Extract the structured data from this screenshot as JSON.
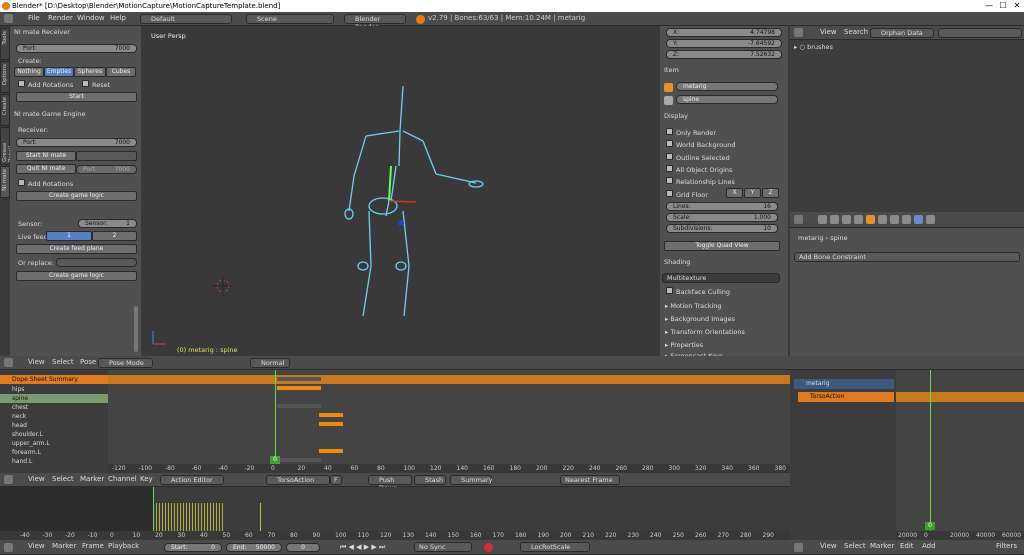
{
  "window": {
    "title": "Blender* [D:\\Desktop\\Blender\\MotionCapture\\MotionCaptureTemplate.blend]",
    "min": "—",
    "max": "☐",
    "close": "✕"
  },
  "info_header": {
    "menus": [
      "File",
      "Render",
      "Window",
      "Help"
    ],
    "layout": "Default",
    "scene": "Scene",
    "engine": "Blender Render",
    "stats": "v2.79 | Bones:63/63 | Mem:10.24M | metarig"
  },
  "left_tabs": [
    "Tools",
    "Options",
    "Create",
    "Grease Pencil",
    "NI mate"
  ],
  "ni_receiver": {
    "title": "NI mate Receiver",
    "port_label": "Port:",
    "port_value": "7000",
    "create_label": "Create:",
    "create_opts": [
      "Nothing",
      "Empties",
      "Spheres",
      "Cubes"
    ],
    "add_rotations": "Add Rotations",
    "reset": "Reset",
    "start": "Start"
  },
  "ni_game": {
    "title": "NI mate Game Engine",
    "receiver_label": "Receiver:",
    "port_label": "Port:",
    "port_value": "7000",
    "start_ni": "Start NI mate",
    "quit_ni": "Quit NI mate",
    "port2_label": "Port:",
    "port2_value": "7000",
    "add_rotations": "Add Rotations",
    "create_logic": "Create game logic",
    "sensor_label": "Sensor:",
    "sensor_field": "Sensor:",
    "sensor_value": "1",
    "livefeed_label": "Live feed:",
    "feed1": "1",
    "feed2": "2",
    "create_feed": "Create feed plane",
    "or_replace": "Or replace:",
    "create_logic2": "Create game logic"
  },
  "viewport": {
    "label": "User Persp",
    "status": "(0) metarig : spine"
  },
  "view3d_header": {
    "menus": [
      "View",
      "Select",
      "Pose"
    ],
    "mode": "Pose Mode",
    "pivot": "Normal"
  },
  "props": {
    "x_label": "X:",
    "x": "4.74798",
    "y_label": "Y:",
    "y": "-7.64592",
    "z_label": "Z:",
    "z": "7.52632",
    "item_title": "Item",
    "obj_name": "metarig",
    "bone_name": "spine",
    "display_title": "Display",
    "only_render": "Only Render",
    "world_bg": "World Background",
    "outline_sel": "Outline Selected",
    "all_origins": "All Object Origins",
    "rel_lines": "Relationship Lines",
    "grid_floor": "Grid Floor",
    "gx": "X",
    "gy": "Y",
    "gz": "Z",
    "lines_label": "Lines:",
    "lines": "16",
    "scale_label": "Scale:",
    "scale": "1.000",
    "subdiv_label": "Subdivisions:",
    "subdiv": "10",
    "toggle_quad": "Toggle Quad View",
    "shading_title": "Shading",
    "shading_mode": "Multitexture",
    "backface": "Backface Culling",
    "motion_tracking": "Motion Tracking",
    "bg_images": "Background Images",
    "transform_orient": "Transform Orientations",
    "properties": "Properties",
    "screenshot_keys": "Screencast Keys"
  },
  "outliner": {
    "menus": [
      "View",
      "Search"
    ],
    "display": "Orphan Data",
    "item": "brushes"
  },
  "bone_props": {
    "obj": "metarig",
    "bone": "spine",
    "add_constraint": "Add Bone Constraint"
  },
  "dopesheet": {
    "summary": "Dope Sheet Summary",
    "channels": [
      "hips",
      "spine",
      "chest",
      "neck",
      "head",
      "shoulder.L",
      "upper_arm.L",
      "forearm.L",
      "hand.L"
    ],
    "ruler": [
      "-120",
      "-100",
      "-80",
      "-60",
      "-40",
      "-20",
      "0",
      "20",
      "40",
      "60",
      "80",
      "100",
      "120",
      "140",
      "160",
      "180",
      "200",
      "220",
      "240",
      "260",
      "280",
      "300",
      "320",
      "340",
      "360",
      "380"
    ],
    "current": "0"
  },
  "ds_header": {
    "menus": [
      "View",
      "Select",
      "Marker",
      "Channel",
      "Key"
    ],
    "mode": "Action Editor",
    "action": "TorsoAction",
    "frame_f": "F",
    "push_down": "Push Down",
    "stash": "Stash",
    "summary": "Summary",
    "snap": "Nearest Frame"
  },
  "nla": {
    "obj": "metarig",
    "action": "TorsoAction",
    "ruler": [
      "20000",
      "0",
      "20000",
      "40000",
      "60000"
    ],
    "current": "0"
  },
  "nla_header": {
    "menus": [
      "View",
      "Select",
      "Marker",
      "Edit",
      "Add"
    ],
    "filters": "Filters"
  },
  "timeline": {
    "ruler": [
      "-40",
      "-30",
      "-20",
      "-10",
      "0",
      "10",
      "20",
      "30",
      "40",
      "50",
      "60",
      "70",
      "80",
      "90",
      "100",
      "110",
      "120",
      "130",
      "140",
      "150",
      "160",
      "170",
      "180",
      "190",
      "200",
      "210",
      "220",
      "230",
      "240",
      "250",
      "260",
      "270",
      "280",
      "290"
    ],
    "current": "0"
  },
  "tl_header": {
    "menus": [
      "View",
      "Marker",
      "Frame",
      "Playback"
    ],
    "start_label": "Start:",
    "start": "0",
    "end_label": "End:",
    "end": "50000",
    "frame": "0",
    "sync": "No Sync",
    "keying": "LocRotScale"
  }
}
